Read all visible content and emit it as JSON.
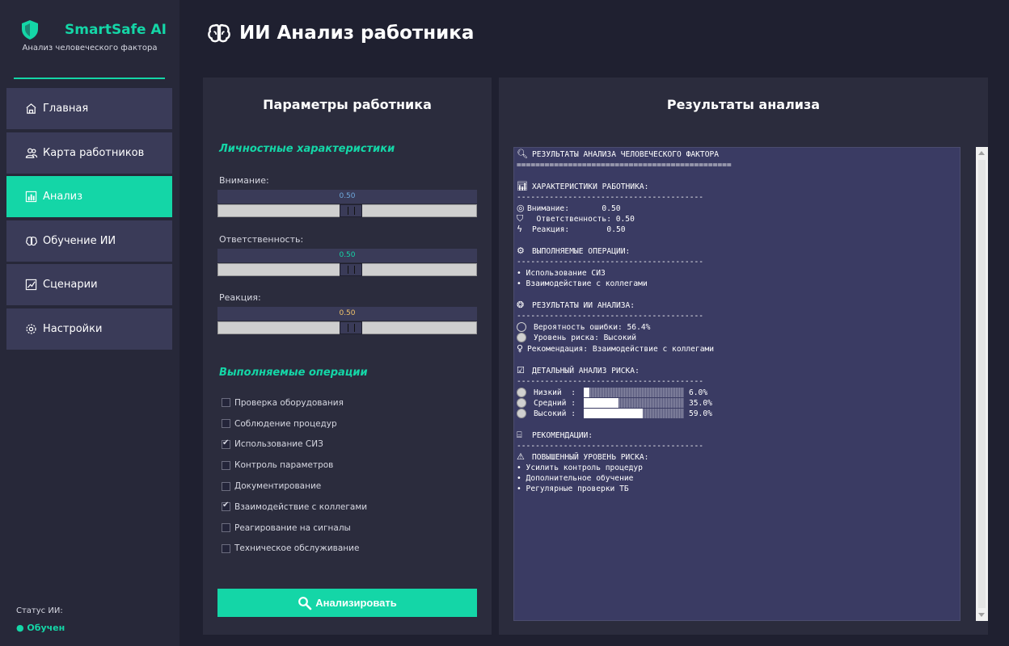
{
  "app": {
    "title": "SmartSafe AI",
    "subtitle": "Анализ человеческого фактора"
  },
  "sidebar": {
    "items": [
      {
        "label": "Главная",
        "icon": "home-icon",
        "active": false
      },
      {
        "label": "Карта работников",
        "icon": "users-icon",
        "active": false
      },
      {
        "label": "Анализ",
        "icon": "bar-chart-icon",
        "active": true
      },
      {
        "label": "Обучение ИИ",
        "icon": "brain-icon",
        "active": false
      },
      {
        "label": "Сценарии",
        "icon": "chart-line-icon",
        "active": false
      },
      {
        "label": "Настройки",
        "icon": "gear-icon",
        "active": false
      }
    ],
    "status_label": "Статус ИИ:",
    "status_value": "● Обучен"
  },
  "header": {
    "title": "ИИ Анализ работника",
    "icon": "brain-icon"
  },
  "params": {
    "title": "Параметры работника",
    "personal_section": "Личностные характеристики",
    "sliders": [
      {
        "label": "Внимание:",
        "value": 0.5,
        "value_text": "0.50",
        "color": "#6fa8dc"
      },
      {
        "label": "Ответственность:",
        "value": 0.5,
        "value_text": "0.50",
        "color": "#14d6a7"
      },
      {
        "label": "Реакция:",
        "value": 0.5,
        "value_text": "0.50",
        "color": "#f2c36b"
      }
    ],
    "ops_section": "Выполняемые операции",
    "operations": [
      {
        "label": "Проверка оборудования",
        "checked": false
      },
      {
        "label": "Соблюдение процедур",
        "checked": false
      },
      {
        "label": "Использование СИЗ",
        "checked": true
      },
      {
        "label": "Контроль параметров",
        "checked": false
      },
      {
        "label": "Документирование",
        "checked": false
      },
      {
        "label": "Взаимодействие с коллегами",
        "checked": true
      },
      {
        "label": "Реагирование на сигналы",
        "checked": false
      },
      {
        "label": "Техническое обслуживание",
        "checked": false
      }
    ],
    "analyze_button": "Анализировать"
  },
  "results": {
    "title": "Результаты анализа",
    "header": "РЕЗУЛЬТАТЫ АНАЛИЗА ЧЕЛОВЕЧЕСКОГО ФАКТОРА",
    "double_rule": "==============================================",
    "rule": "----------------------------------------",
    "traits_title": "ХАРАКТЕРИСТИКИ РАБОТНИКА:",
    "trait_attention": "Внимание:       0.50",
    "trait_responsibility": "  Ответственность: 0.50",
    "trait_reaction": "Реакция:        0.50",
    "ops_title": "ВЫПОЛНЯЕМЫЕ ОПЕРАЦИИ:",
    "ops": [
      "• Использование СИЗ",
      "• Взаимодействие с коллегами"
    ],
    "ai_title": "РЕЗУЛЬТАТЫ ИИ АНАЛИЗА:",
    "error_prob": "Вероятность ошибки: 56.4%",
    "risk_level": "Уровень риска: Высокий",
    "recommendation": "Рекомендация: Взаимодействие с коллегами",
    "detail_title": "ДЕТАЛЬНЫЙ АНАЛИЗ РИСКА:",
    "risks": [
      {
        "label": "Низкий  :",
        "value": 6.0,
        "value_text": "6.0%"
      },
      {
        "label": "Средний :",
        "value": 35.0,
        "value_text": "35.0%"
      },
      {
        "label": "Высокий :",
        "value": 59.0,
        "value_text": "59.0%"
      }
    ],
    "rec_title": "РЕКОМЕНДАЦИИ:",
    "warning": "ПОВЫШЕННЫЙ УРОВЕНЬ РИСКА:",
    "rec_items": [
      "• Усилить контроль процедур",
      "• Дополнительное обучение",
      "• Регулярные проверки ТБ"
    ]
  },
  "colors": {
    "accent": "#14d6a7",
    "sidebar_bg": "#272839",
    "panel_bg": "#2b2c3d",
    "item_bg": "#3a3b58"
  }
}
